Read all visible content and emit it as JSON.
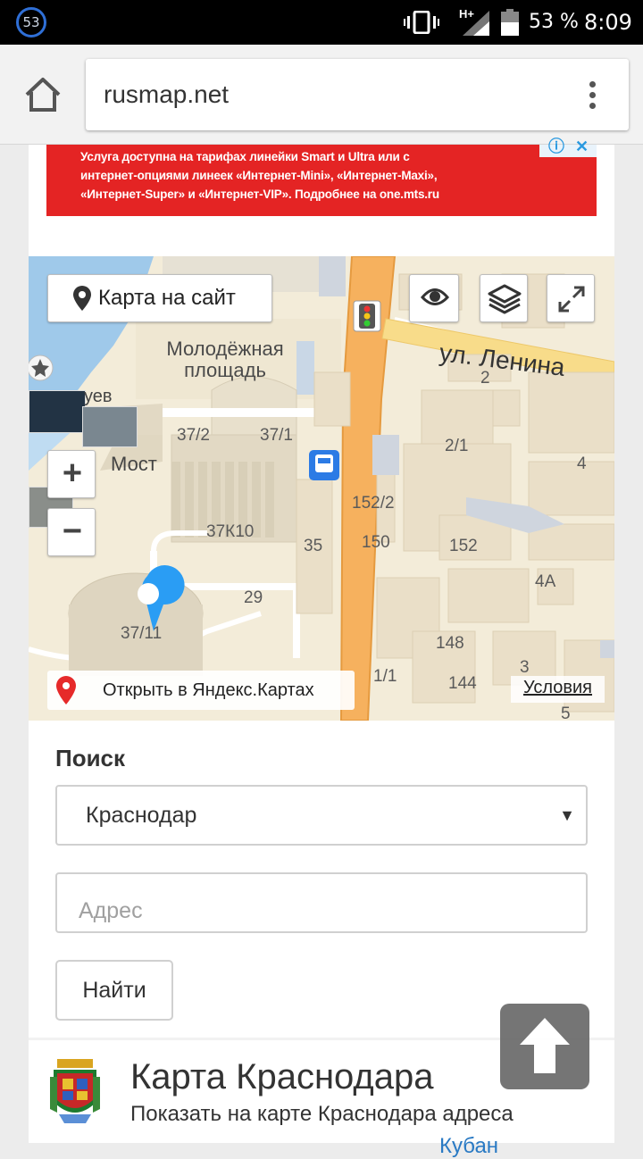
{
  "status_bar": {
    "badge": "53",
    "network": "H+",
    "battery_percent": "53 %",
    "time": "8:09"
  },
  "browser": {
    "url": "rusmap.net"
  },
  "ad": {
    "lines": [
      "Услуга доступна на тарифах линейки Smart и Ultra или с",
      "интернет-опциями линеек «Интернет-Mini», «Интернет-Maxi»,",
      "«Интернет-Super» и «Интернет-VIP». Подробнее на one.mts.ru"
    ]
  },
  "map": {
    "site_button": "Карта на сайт",
    "street_label": "ул. Ленина",
    "square_label": "Молодёжная площадь",
    "label_most": "Мост",
    "label_partial": "уев",
    "open_in_yandex": "Открыть в Яндекс.Картах",
    "terms": "Условия",
    "house_numbers": [
      "37/2",
      "37/1",
      "37К10",
      "35",
      "29",
      "37/11",
      "152/2",
      "150",
      "152",
      "148",
      "144",
      "1/1",
      "2",
      "2/1",
      "4",
      "4А",
      "3",
      "5"
    ]
  },
  "search": {
    "title": "Поиск",
    "city": "Краснодар",
    "address_placeholder": "Адрес",
    "find_button": "Найти"
  },
  "card": {
    "title": "Карта Краснодара",
    "description": "Показать на карте Краснодара адреса",
    "link_partial": "Кубан"
  },
  "colors": {
    "ad_red": "#e42424",
    "road_orange": "#f6b15e",
    "map_land": "#f3ecd9",
    "water": "#9fc9ea",
    "pin_blue": "#2a9df4",
    "link_blue": "#2a7ac4"
  }
}
